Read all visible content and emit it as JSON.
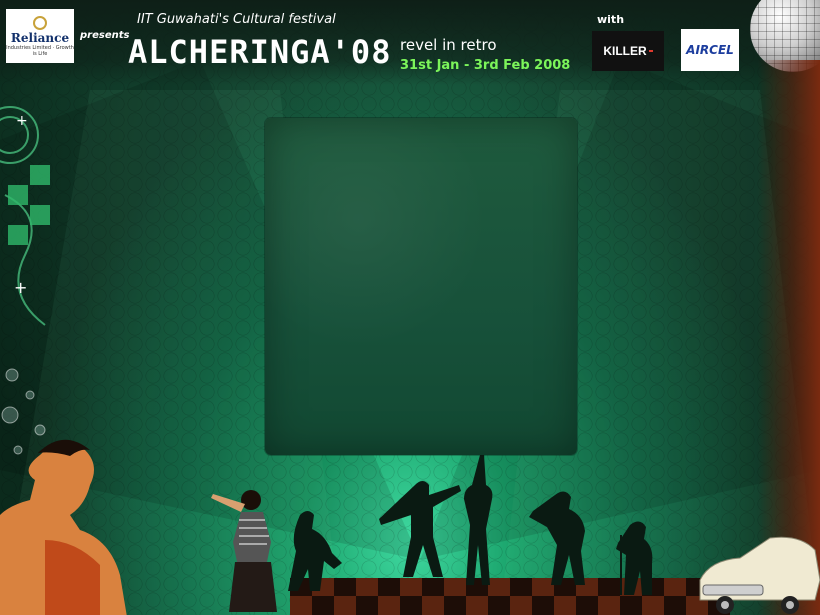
{
  "header": {
    "sponsor_logo_text": "Reliance",
    "sponsor_logo_subtext": "Industries Limited · Growth is Life",
    "presents": "presents",
    "festival_line": "IIT Guwahati's Cultural festival",
    "title": "ALCHERINGA'08",
    "tagline": "revel in retro",
    "dates": "31st Jan - 3rd Feb 2008",
    "with": "with",
    "partner1": "KILLER",
    "partner2": "AIRCEL"
  },
  "colors": {
    "background": "#0b2a1c",
    "dates_green": "#7cf55a",
    "panel": "#17513a"
  },
  "icons": [
    "disco-ball-icon",
    "reliance-logo",
    "killer-logo",
    "aircel-logo"
  ]
}
